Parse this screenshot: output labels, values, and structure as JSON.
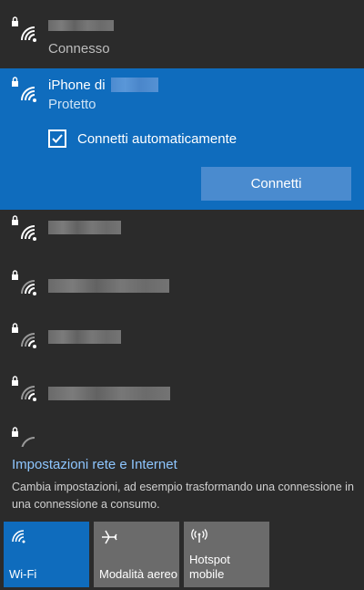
{
  "networks": {
    "connected": {
      "status": "Connesso"
    },
    "selected": {
      "name": "iPhone di",
      "status": "Protetto",
      "auto_connect_label": "Connetti automaticamente",
      "auto_connect_checked": true,
      "connect_button": "Connetti"
    }
  },
  "settings": {
    "link": "Impostazioni rete e Internet",
    "description": "Cambia impostazioni, ad esempio trasformando una connessione in una connessione a consumo."
  },
  "quick_actions": {
    "wifi": "Wi-Fi",
    "airplane": "Modalità aereo",
    "hotspot_line1": "Hotspot",
    "hotspot_line2": "mobile"
  },
  "colors": {
    "background": "#2b2b2b",
    "accent": "#0f6cbd",
    "link": "#8ec6ff",
    "tile_inactive": "#6b6b6b"
  }
}
